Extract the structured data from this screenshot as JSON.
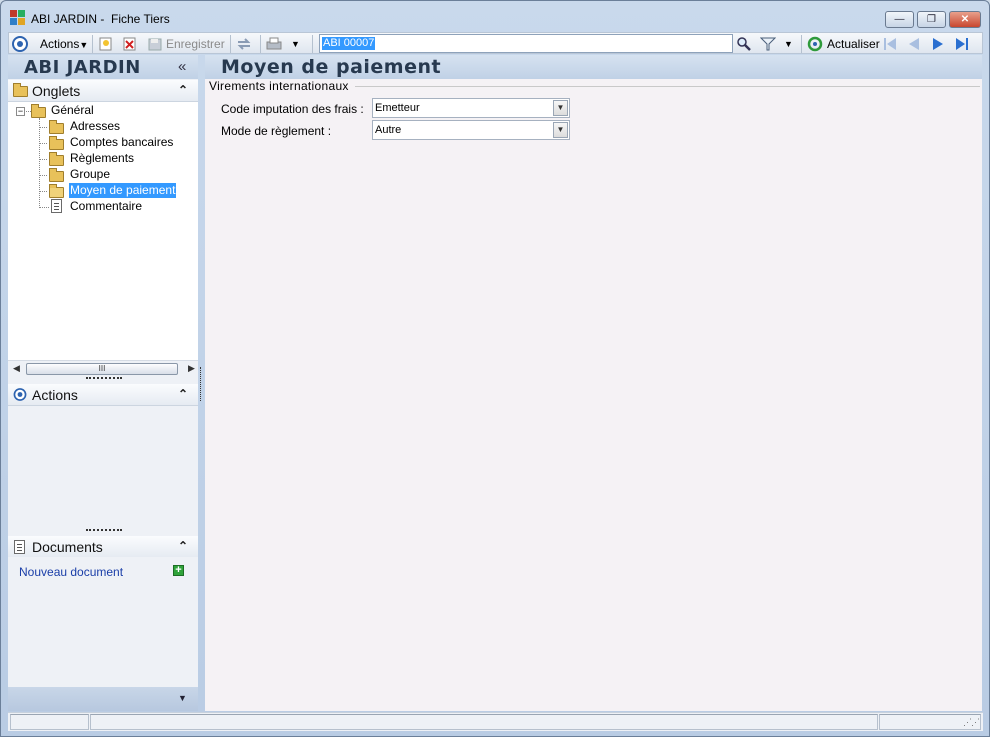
{
  "window": {
    "app_name": "ABI JARDIN -",
    "doc_title": "Fiche Tiers",
    "minimize": "—",
    "restore": "❐",
    "close": "✕"
  },
  "toolbar": {
    "actions_label": "Actions",
    "save_label": "Enregistrer",
    "search_value": "ABI 00007",
    "refresh_label": "Actualiser",
    "icons": [
      "target-icon",
      "new-icon",
      "delete-icon",
      "save-icon",
      "sync-icon",
      "print-icon",
      "search-icon",
      "filter-icon",
      "refresh-icon",
      "first-icon",
      "prev-icon",
      "next-icon",
      "last-icon"
    ]
  },
  "left": {
    "company": "ABI JARDIN",
    "collapse_glyph": "«",
    "onglets": {
      "title": "Onglets",
      "tree": {
        "root": "Général",
        "children": [
          "Adresses",
          "Comptes bancaires",
          "Règlements",
          "Groupe",
          "Moyen de paiement",
          "Commentaire"
        ],
        "selected": "Moyen de paiement"
      }
    },
    "scroll_glyph": "III",
    "actions": {
      "title": "Actions"
    },
    "documents": {
      "title": "Documents",
      "new_doc": "Nouveau document"
    }
  },
  "main": {
    "title": "Moyen de paiement",
    "group": "Virements internationaux",
    "fields": [
      {
        "label": "Code imputation des frais :",
        "value": "Emetteur"
      },
      {
        "label": "Mode de règlement :",
        "value": "Autre"
      }
    ]
  },
  "colors": {
    "selection": "#3399ff",
    "header_text": "#27394f",
    "link": "#1a3ea8"
  }
}
